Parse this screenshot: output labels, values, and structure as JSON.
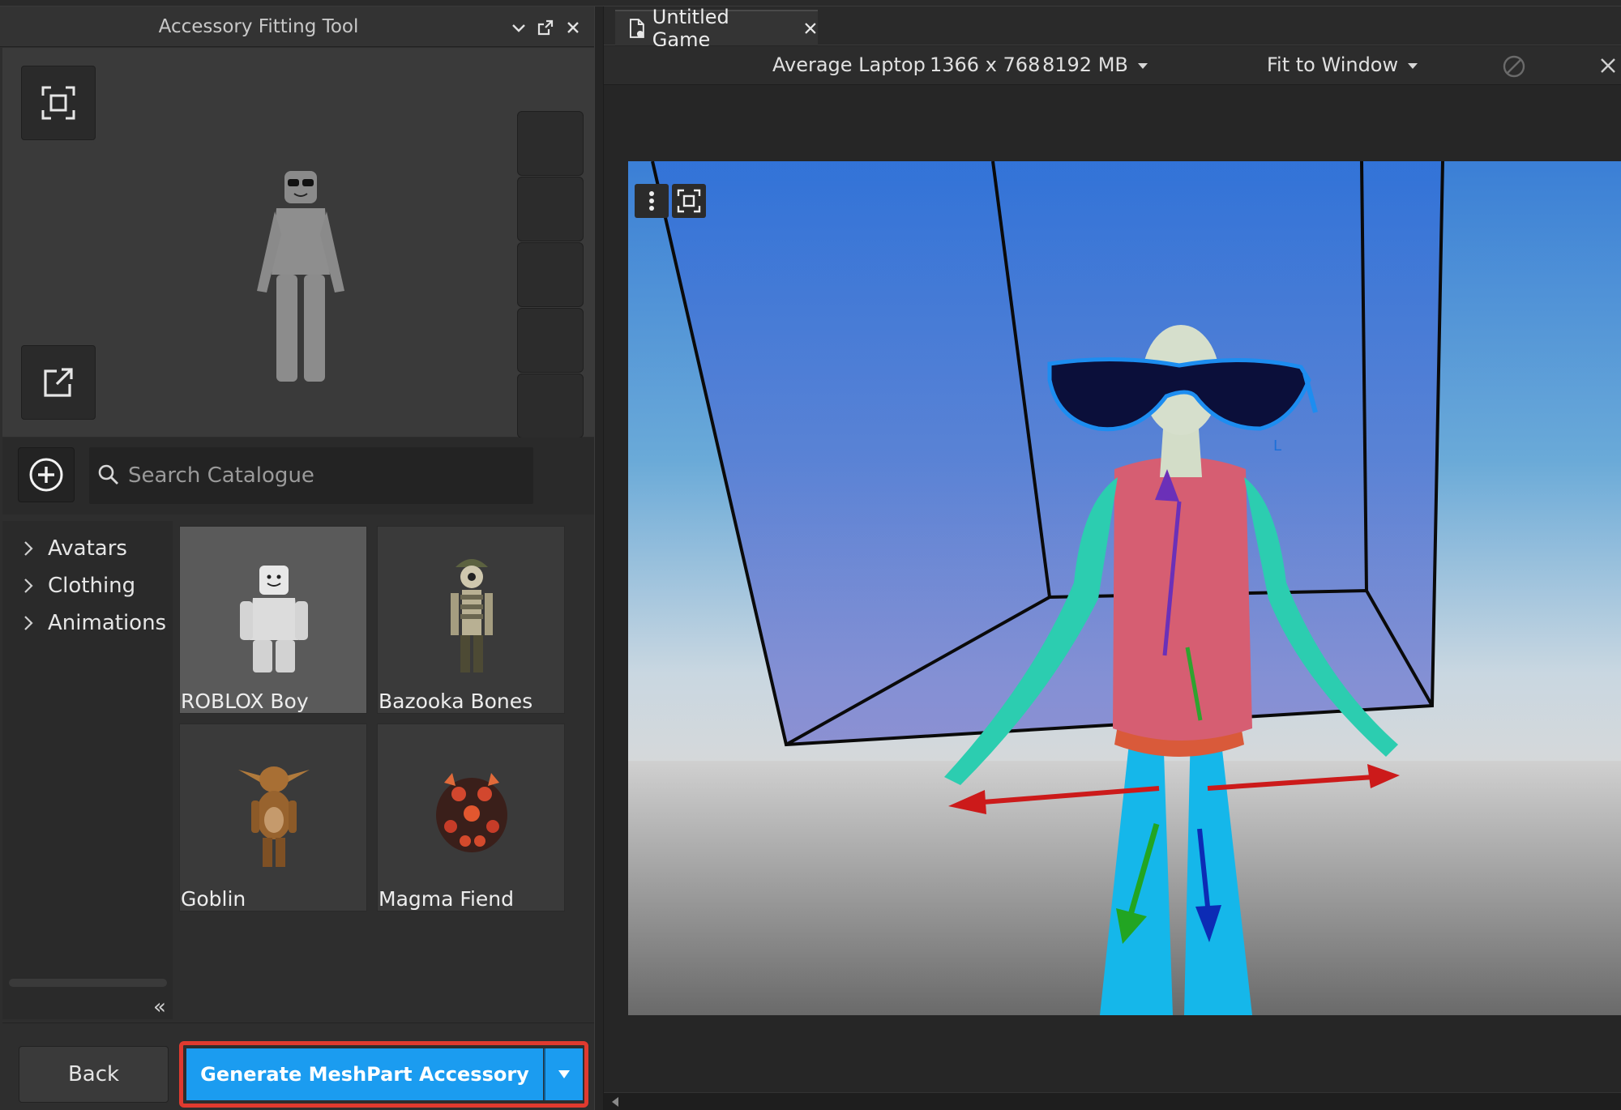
{
  "accessory_panel": {
    "title": "Accessory Fitting Tool",
    "search_placeholder": "Search Catalogue",
    "tree": [
      {
        "label": "Avatars"
      },
      {
        "label": "Clothing"
      },
      {
        "label": "Animations"
      }
    ],
    "catalogue": [
      {
        "name": "ROBLOX Boy",
        "selected": true
      },
      {
        "name": "Bazooka Bones",
        "selected": false
      },
      {
        "name": "Goblin",
        "selected": false
      },
      {
        "name": "Magma Fiend",
        "selected": false
      }
    ],
    "back_label": "Back",
    "generate_label": "Generate MeshPart Accessory"
  },
  "editor": {
    "tab_title": "Untitled Game",
    "device": "Average Laptop",
    "resolution": "1366 x 768",
    "memory": "8192 MB",
    "fit_mode": "Fit to Window"
  },
  "colors": {
    "accent": "#1b9cf0",
    "highlight_border": "#e03a2f",
    "panel_bg": "#2e2e2e"
  }
}
